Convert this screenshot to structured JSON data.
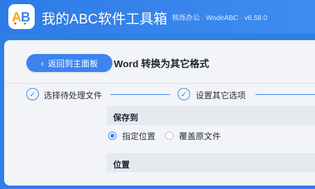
{
  "app": {
    "title": "我的ABC软件工具箱",
    "meta": "核烁办公 · WodeABC · v6.58.0",
    "logo_text": "AB",
    "logo_colors": [
      "#f5a623",
      "#3d84ef",
      "#e8453c",
      "#2ab673"
    ]
  },
  "header": {
    "back_label": "返回到主面板",
    "page_title": "Word 转换为其它格式"
  },
  "steps": [
    {
      "label": "选择待处理文件",
      "state": "done"
    },
    {
      "label": "设置其它选项",
      "state": "current"
    }
  ],
  "form": {
    "save_to": {
      "heading": "保存到",
      "options": [
        {
          "label": "指定位置",
          "checked": true
        },
        {
          "label": "覆盖原文件",
          "checked": false
        }
      ]
    },
    "location": {
      "heading": "位置"
    }
  },
  "colors": {
    "accent": "#3d84ef",
    "titlebar": "#2f7fe6",
    "panel": "#f2f4f7"
  }
}
